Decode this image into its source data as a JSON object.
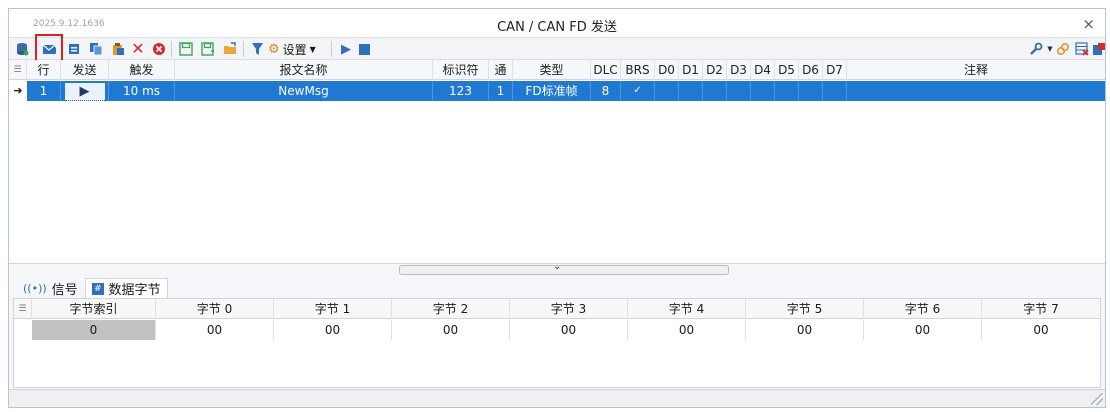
{
  "window": {
    "timestamp": "2025.9.12.1636",
    "title": "CAN / CAN FD 发送",
    "close": "×"
  },
  "toolbar": {
    "settings_label": "设置"
  },
  "grid": {
    "columns": [
      "行",
      "发送",
      "触发",
      "报文名称",
      "标识符",
      "通道",
      "类型",
      "DLC",
      "BRS",
      "D0",
      "D1",
      "D2",
      "D3",
      "D4",
      "D5",
      "D6",
      "D7",
      "注释"
    ],
    "rows": [
      {
        "row": "1",
        "trigger": "10 ms",
        "name": "NewMsg",
        "id": "123",
        "channel": "1",
        "type": "FD标准帧",
        "dlc": "8",
        "brs": "✓",
        "d0": "",
        "d1": "",
        "d2": "",
        "d3": "",
        "d4": "",
        "d5": "",
        "d6": "",
        "d7": "",
        "comment": ""
      }
    ]
  },
  "tabs": [
    {
      "label": "信号",
      "icon": "signal-icon"
    },
    {
      "label": "数据字节",
      "icon": "hash-icon",
      "active": true
    }
  ],
  "bytes": {
    "columns": [
      "字节索引",
      "字节 0",
      "字节 1",
      "字节 2",
      "字节 3",
      "字节 4",
      "字节 5",
      "字节 6",
      "字节 7"
    ],
    "rows": [
      {
        "index": "0",
        "b0": "00",
        "b1": "00",
        "b2": "00",
        "b3": "00",
        "b4": "00",
        "b5": "00",
        "b6": "00",
        "b7": "00"
      }
    ]
  },
  "colors": {
    "selection": "#1f78d1",
    "highlight_box": "#e02020"
  }
}
